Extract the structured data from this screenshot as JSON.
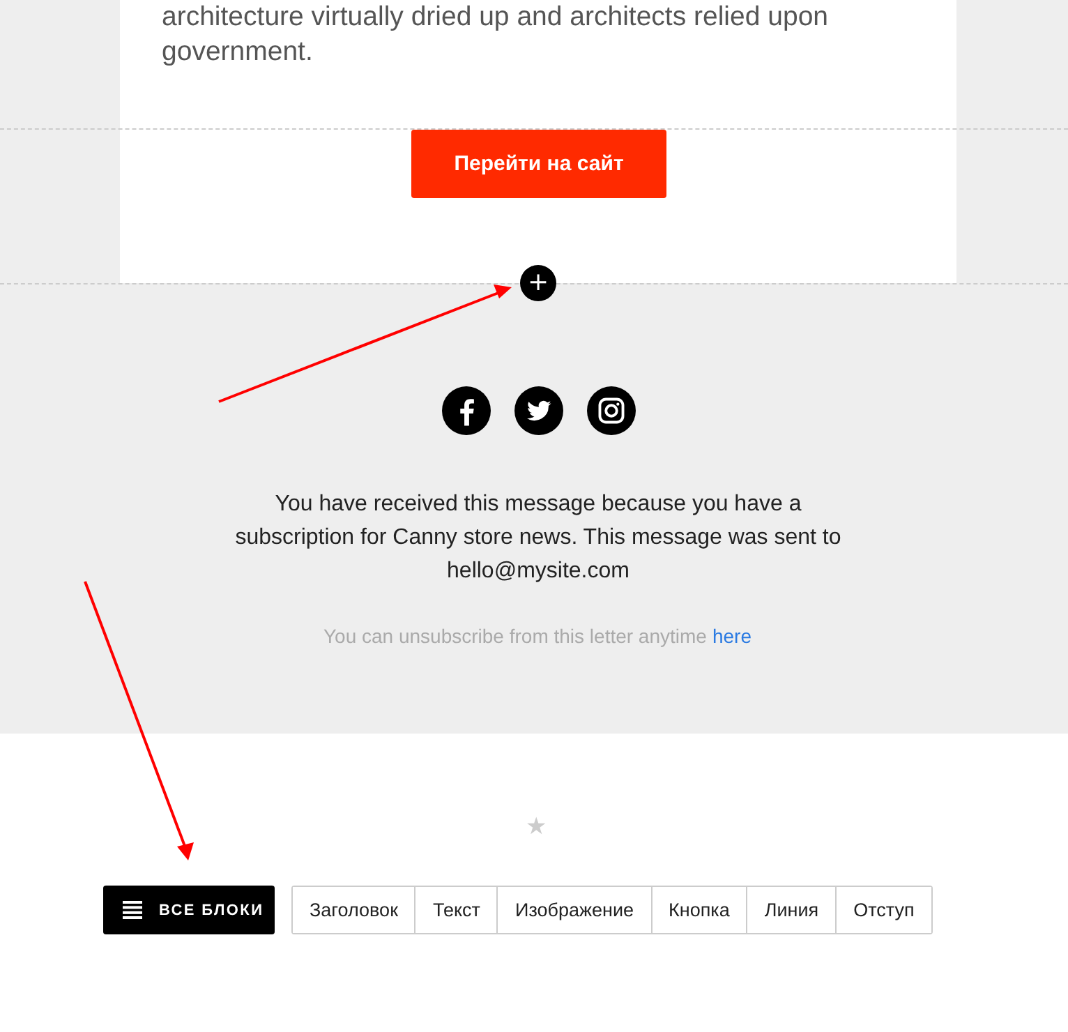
{
  "article": {
    "text": "architecture virtually dried up and architects relied upon government."
  },
  "cta_button": {
    "label": "Перейти на сайт"
  },
  "add_block_button": {
    "label": "+"
  },
  "footer": {
    "message": "You have received this message because you have a subscription for Canny store news. This message was sent to hello@mysite.com",
    "unsubscribe": {
      "text": "You can unsubscribe from this letter anytime",
      "link": "here"
    }
  },
  "favorite": {
    "label": "★"
  },
  "toolbar": {
    "all_blocks": "ВСЕ БЛОКИ",
    "blocks": [
      {
        "label": "Заголовок"
      },
      {
        "label": "Текст"
      },
      {
        "label": "Изображение"
      },
      {
        "label": "Кнопка"
      },
      {
        "label": "Линия"
      },
      {
        "label": "Отступ"
      }
    ]
  }
}
